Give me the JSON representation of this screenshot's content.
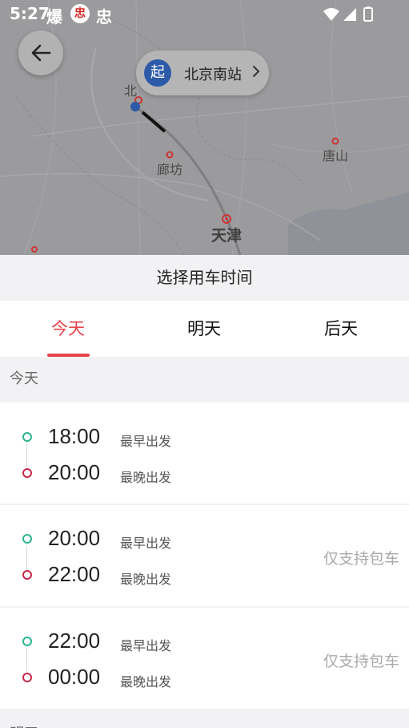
{
  "status_bar": {
    "time": "5:27",
    "app_icon_1": "爆",
    "app_icon_2": "忠",
    "app_icon_3": "忠",
    "system_icons": "wifi-icon signal-icon battery-icon"
  },
  "map": {
    "labels": {
      "beijing": "北",
      "langfang": "廊坊",
      "tangshan": "唐山",
      "tianjin": "天津"
    },
    "start_point": {
      "badge": "起",
      "name": "北京南站"
    }
  },
  "panel": {
    "title": "选择用车时间"
  },
  "tabs": [
    {
      "label": "今天",
      "active": true
    },
    {
      "label": "明天",
      "active": false
    },
    {
      "label": "后天",
      "active": false
    }
  ],
  "section": {
    "today_label": "今天",
    "next_label": "明天"
  },
  "slots": [
    {
      "earliest_time": "18:00",
      "earliest_label": "最早出发",
      "latest_time": "20:00",
      "latest_label": "最晚出发",
      "note": ""
    },
    {
      "earliest_time": "20:00",
      "earliest_label": "最早出发",
      "latest_time": "22:00",
      "latest_label": "最晚出发",
      "note": "仅支持包车"
    },
    {
      "earliest_time": "22:00",
      "earliest_label": "最早出发",
      "latest_time": "00:00",
      "latest_label": "最晚出发",
      "note": "仅支持包车"
    }
  ],
  "colors": {
    "accent": "#e8424c",
    "green_dot": "#2bb58f",
    "red_dot": "#c8284a"
  }
}
